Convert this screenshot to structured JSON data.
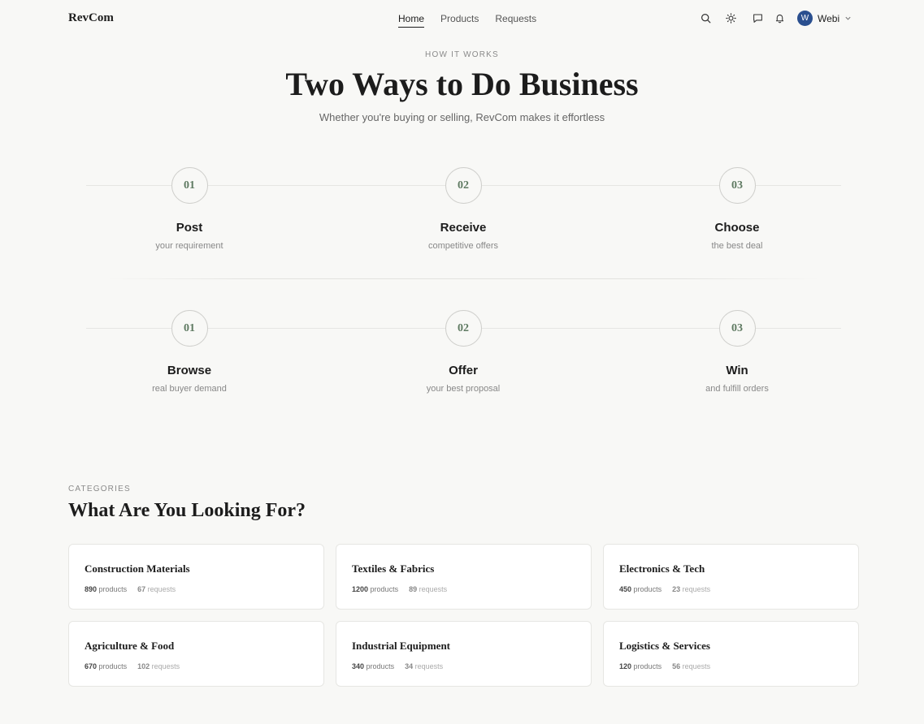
{
  "header": {
    "logo": "RevCom",
    "nav": [
      "Home",
      "Products",
      "Requests"
    ],
    "user": {
      "initial": "W",
      "name": "Webi"
    },
    "icons": [
      "search-icon",
      "theme-toggle-icon",
      "messages-icon",
      "bell-icon",
      "chevron-down-icon"
    ]
  },
  "how": {
    "eyebrow": "HOW IT WORKS",
    "title": "Two Ways to Do Business",
    "subtitle": "Whether you're buying or selling, RevCom makes it effortless",
    "buy_steps": [
      {
        "num": "01",
        "title": "Post",
        "sub": "your requirement"
      },
      {
        "num": "02",
        "title": "Receive",
        "sub": "competitive offers"
      },
      {
        "num": "03",
        "title": "Choose",
        "sub": "the best deal"
      }
    ],
    "sell_steps": [
      {
        "num": "01",
        "title": "Browse",
        "sub": "real buyer demand"
      },
      {
        "num": "02",
        "title": "Offer",
        "sub": "your best proposal"
      },
      {
        "num": "03",
        "title": "Win",
        "sub": "and fulfill orders"
      }
    ]
  },
  "categories": {
    "eyebrow": "CATEGORIES",
    "title": "What Are You Looking For?",
    "products_label": "products",
    "requests_label": "requests",
    "items": [
      {
        "name": "Construction Materials",
        "products": "890",
        "requests": "67"
      },
      {
        "name": "Textiles & Fabrics",
        "products": "1200",
        "requests": "89"
      },
      {
        "name": "Electronics & Tech",
        "products": "450",
        "requests": "23"
      },
      {
        "name": "Agriculture & Food",
        "products": "670",
        "requests": "102"
      },
      {
        "name": "Industrial Equipment",
        "products": "340",
        "requests": "34"
      },
      {
        "name": "Logistics & Services",
        "products": "120",
        "requests": "56"
      }
    ]
  },
  "colors": {
    "accent_number": "#5f7a62",
    "avatar": "#2a4f8f",
    "background": "#f8f8f6"
  }
}
